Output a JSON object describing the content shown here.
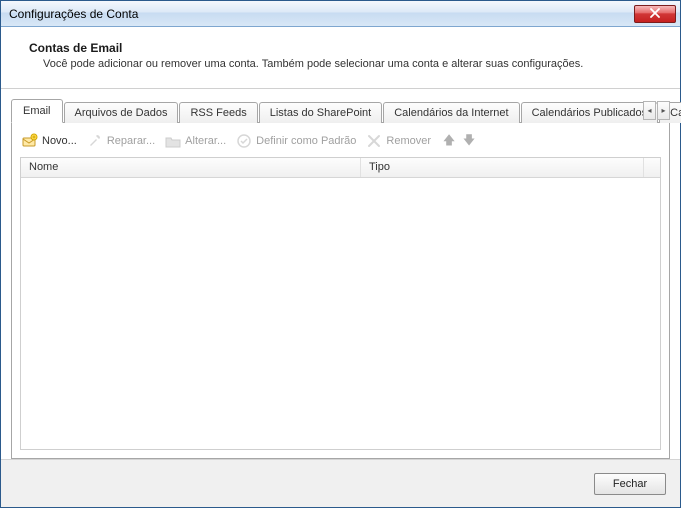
{
  "window": {
    "title": "Configurações de Conta"
  },
  "header": {
    "title": "Contas de Email",
    "description": "Você pode adicionar ou remover uma conta. Também pode selecionar uma conta e alterar suas configurações."
  },
  "tabs": [
    {
      "label": "Email",
      "active": true
    },
    {
      "label": "Arquivos de Dados",
      "active": false
    },
    {
      "label": "RSS Feeds",
      "active": false
    },
    {
      "label": "Listas do SharePoint",
      "active": false
    },
    {
      "label": "Calendários da Internet",
      "active": false
    },
    {
      "label": "Calendários Publicados",
      "active": false
    },
    {
      "label": "Catálogos",
      "active": false
    }
  ],
  "toolbar": {
    "new": {
      "label": "Novo...",
      "enabled": true
    },
    "repair": {
      "label": "Reparar...",
      "enabled": false
    },
    "change": {
      "label": "Alterar...",
      "enabled": false
    },
    "setdefault": {
      "label": "Definir como Padrão",
      "enabled": false
    },
    "remove": {
      "label": "Remover",
      "enabled": false
    }
  },
  "list": {
    "columns": {
      "name": "Nome",
      "type": "Tipo"
    },
    "rows": []
  },
  "footer": {
    "close": "Fechar"
  }
}
